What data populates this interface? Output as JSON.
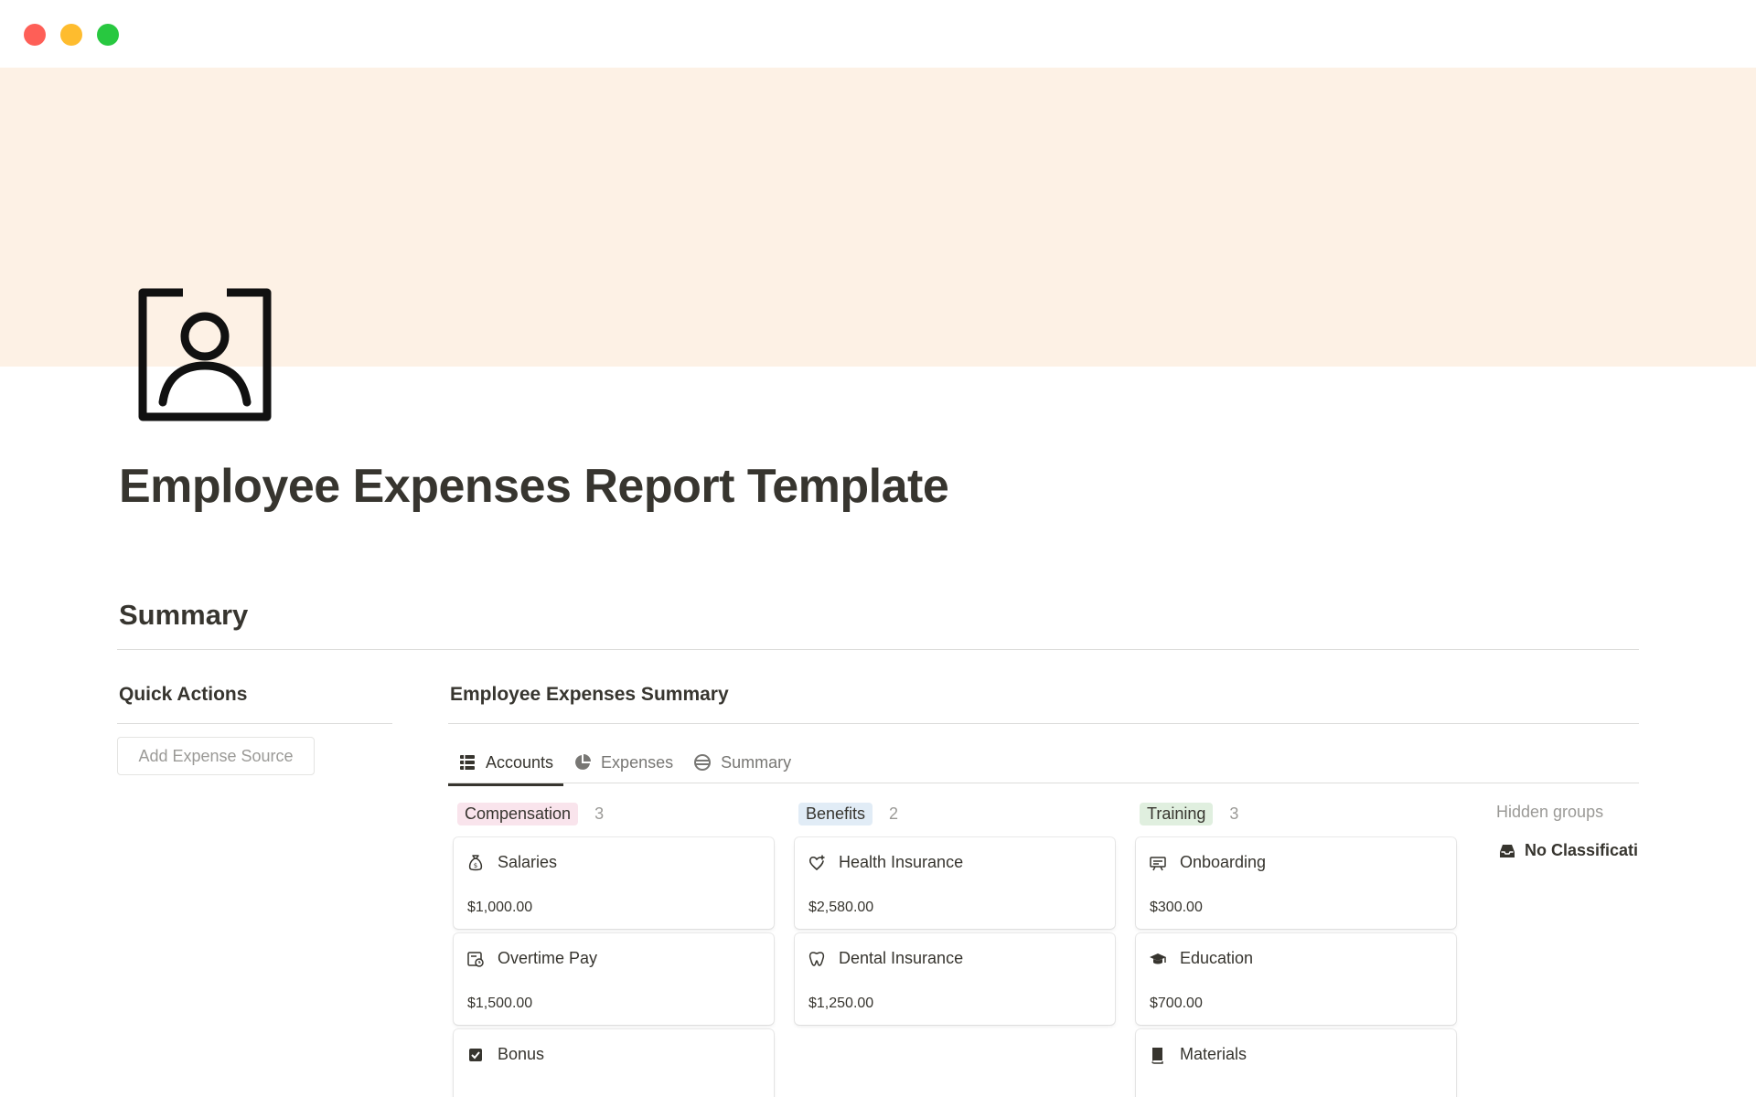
{
  "page": {
    "title": "Employee Expenses Report Template",
    "icon": "contact-card-icon",
    "cover_color": "#fdf1e5"
  },
  "window": {
    "traffic_lights": [
      "#fe5f57",
      "#febc2e",
      "#28c840"
    ]
  },
  "summary": {
    "heading": "Summary",
    "quick_actions": {
      "heading": "Quick Actions",
      "add_button_label": "Add Expense Source"
    },
    "board": {
      "heading": "Employee Expenses Summary",
      "tabs": [
        {
          "label": "Accounts",
          "icon": "table-icon",
          "active": true
        },
        {
          "label": "Expenses",
          "icon": "pie-chart-icon",
          "active": false
        },
        {
          "label": "Summary",
          "icon": "dollar-globe-icon",
          "active": false
        }
      ],
      "groups": [
        {
          "name": "Compensation",
          "count": "3",
          "color": "#f9e4ec",
          "cards": [
            {
              "title": "Salaries",
              "icon": "money-bag-icon",
              "amount": "$1,000.00"
            },
            {
              "title": "Overtime Pay",
              "icon": "timesheet-icon",
              "amount": "$1,500.00"
            },
            {
              "title": "Bonus",
              "icon": "checkbox-icon",
              "amount": ""
            }
          ]
        },
        {
          "name": "Benefits",
          "count": "2",
          "color": "#e1ecf6",
          "cards": [
            {
              "title": "Health Insurance",
              "icon": "heart-plus-icon",
              "amount": "$2,580.00"
            },
            {
              "title": "Dental Insurance",
              "icon": "tooth-icon",
              "amount": "$1,250.00"
            }
          ]
        },
        {
          "name": "Training",
          "count": "3",
          "color": "#e0efdf",
          "cards": [
            {
              "title": "Onboarding",
              "icon": "presentation-icon",
              "amount": "$300.00"
            },
            {
              "title": "Education",
              "icon": "graduation-cap-icon",
              "amount": "$700.00"
            },
            {
              "title": "Materials",
              "icon": "book-icon",
              "amount": ""
            }
          ]
        }
      ],
      "hidden_groups": {
        "label": "Hidden groups",
        "items": [
          {
            "label": "No Classificati",
            "icon": "inbox-icon"
          }
        ]
      }
    }
  }
}
